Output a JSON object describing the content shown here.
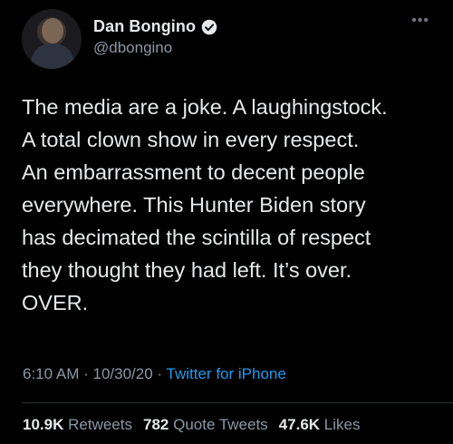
{
  "author": {
    "display_name": "Dan Bongino",
    "handle": "@dbongino",
    "verified": true
  },
  "icons": {
    "more": "more-options-icon",
    "verified": "verified-badge-icon"
  },
  "tweet": {
    "text": "The media are a joke. A laughingstock.\nA total clown show in every respect.\nAn embarrassment to decent people\neverywhere. This Hunter Biden story\nhas decimated the scintilla of respect\nthey thought they had left. It’s over.\nOVER.",
    "time": "6:10 AM",
    "separator": "·",
    "date": "10/30/20",
    "source": "Twitter for iPhone"
  },
  "stats": {
    "retweets_count": "10.9K",
    "retweets_label": "Retweets",
    "quotes_count": "782",
    "quotes_label": "Quote Tweets",
    "likes_count": "47.6K",
    "likes_label": "Likes"
  },
  "colors": {
    "background": "#000000",
    "accent": "#1d9bf0",
    "muted": "#8b98a5",
    "text": "#e7e9ea"
  }
}
